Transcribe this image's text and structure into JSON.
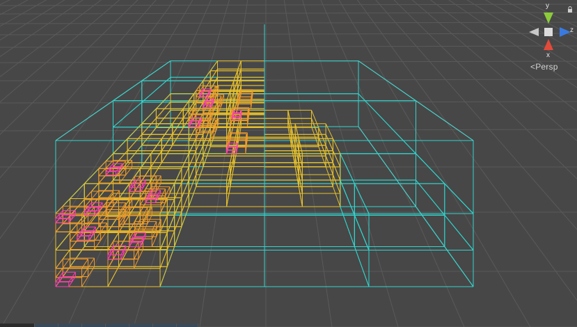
{
  "scene": {
    "background": "#474747",
    "grid_color": "#5a5a5a",
    "box_colors": {
      "root": "#f2d6c9",
      "level1": "#2fd6cf",
      "level2": "#e8c12a",
      "level3": "#f09a2a",
      "level4": "#ff3db0"
    },
    "accent_color": "#f08aa8"
  },
  "gizmo": {
    "y_label": "y",
    "x_label": "x",
    "z_label": "z",
    "projection_label": "Persp",
    "projection_icon": "chevron-left-icon",
    "y_color": "#8ccc3a",
    "x_color": "#e24a3a",
    "z_color": "#3a7ae0",
    "lock_icon": "lock-icon"
  }
}
